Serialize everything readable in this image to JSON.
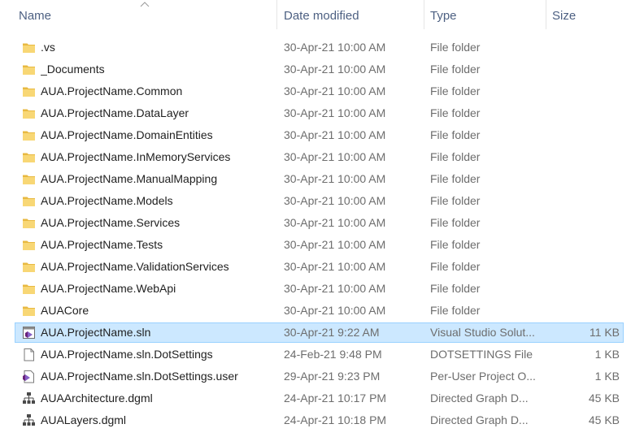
{
  "columns": {
    "name": "Name",
    "date": "Date modified",
    "type": "Type",
    "size": "Size"
  },
  "files": [
    {
      "name": ".vs",
      "date": "30-Apr-21 10:00 AM",
      "type": "File folder",
      "size": "",
      "icon": "folder-icon"
    },
    {
      "name": "_Documents",
      "date": "30-Apr-21 10:00 AM",
      "type": "File folder",
      "size": "",
      "icon": "folder-icon"
    },
    {
      "name": "AUA.ProjectName.Common",
      "date": "30-Apr-21 10:00 AM",
      "type": "File folder",
      "size": "",
      "icon": "folder-icon"
    },
    {
      "name": "AUA.ProjectName.DataLayer",
      "date": "30-Apr-21 10:00 AM",
      "type": "File folder",
      "size": "",
      "icon": "folder-icon"
    },
    {
      "name": "AUA.ProjectName.DomainEntities",
      "date": "30-Apr-21 10:00 AM",
      "type": "File folder",
      "size": "",
      "icon": "folder-icon"
    },
    {
      "name": "AUA.ProjectName.InMemoryServices",
      "date": "30-Apr-21 10:00 AM",
      "type": "File folder",
      "size": "",
      "icon": "folder-icon"
    },
    {
      "name": "AUA.ProjectName.ManualMapping",
      "date": "30-Apr-21 10:00 AM",
      "type": "File folder",
      "size": "",
      "icon": "folder-icon"
    },
    {
      "name": "AUA.ProjectName.Models",
      "date": "30-Apr-21 10:00 AM",
      "type": "File folder",
      "size": "",
      "icon": "folder-icon"
    },
    {
      "name": "AUA.ProjectName.Services",
      "date": "30-Apr-21 10:00 AM",
      "type": "File folder",
      "size": "",
      "icon": "folder-icon"
    },
    {
      "name": "AUA.ProjectName.Tests",
      "date": "30-Apr-21 10:00 AM",
      "type": "File folder",
      "size": "",
      "icon": "folder-icon"
    },
    {
      "name": "AUA.ProjectName.ValidationServices",
      "date": "30-Apr-21 10:00 AM",
      "type": "File folder",
      "size": "",
      "icon": "folder-icon"
    },
    {
      "name": "AUA.ProjectName.WebApi",
      "date": "30-Apr-21 10:00 AM",
      "type": "File folder",
      "size": "",
      "icon": "folder-icon"
    },
    {
      "name": "AUACore",
      "date": "30-Apr-21 10:00 AM",
      "type": "File folder",
      "size": "",
      "icon": "folder-icon"
    },
    {
      "name": "AUA.ProjectName.sln",
      "date": "30-Apr-21 9:22 AM",
      "type": "Visual Studio Solut...",
      "size": "11 KB",
      "icon": "visual-studio-solution-icon",
      "selected": true
    },
    {
      "name": "AUA.ProjectName.sln.DotSettings",
      "date": "24-Feb-21 9:48 PM",
      "type": "DOTSETTINGS File",
      "size": "1 KB",
      "icon": "blank-file-icon"
    },
    {
      "name": "AUA.ProjectName.sln.DotSettings.user",
      "date": "29-Apr-21 9:23 PM",
      "type": "Per-User Project O...",
      "size": "1 KB",
      "icon": "visual-studio-user-file-icon"
    },
    {
      "name": "AUAArchitecture.dgml",
      "date": "24-Apr-21 10:17 PM",
      "type": "Directed Graph D...",
      "size": "45 KB",
      "icon": "directed-graph-icon"
    },
    {
      "name": "AUALayers.dgml",
      "date": "24-Apr-21 10:18 PM",
      "type": "Directed Graph D...",
      "size": "45 KB",
      "icon": "directed-graph-icon"
    }
  ],
  "colors": {
    "header_text": "#4d6082",
    "selection_bg": "#cce8ff",
    "selection_border": "#99d1ff",
    "folder": "#f8d775"
  }
}
